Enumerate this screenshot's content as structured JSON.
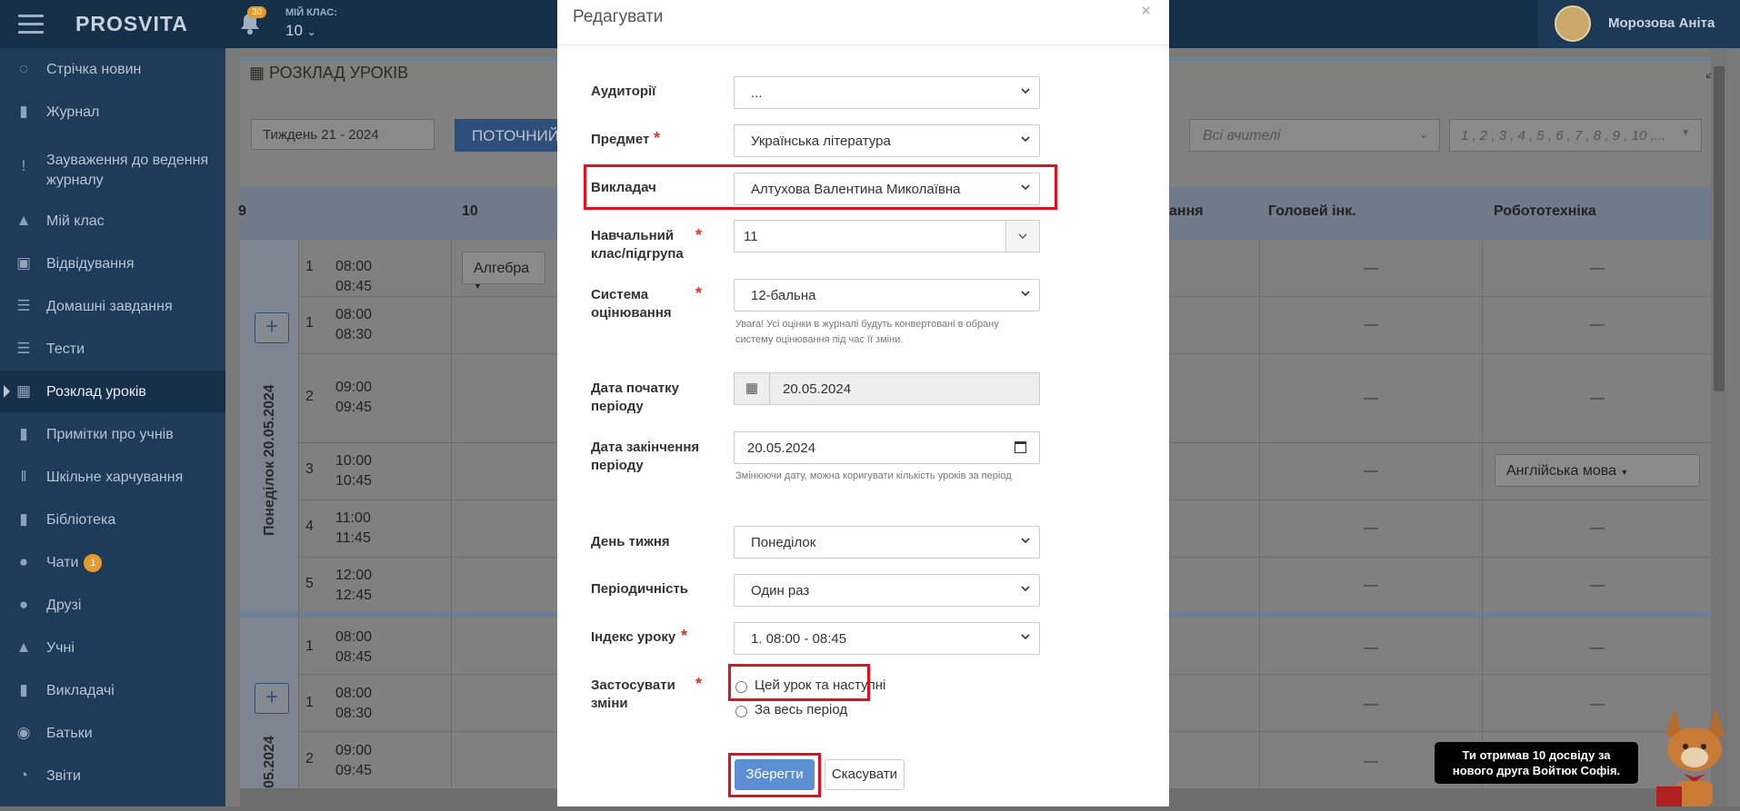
{
  "topbar": {
    "logo": "PROSVITA",
    "notifications_count": "30",
    "my_class_label": "МІЙ КЛАС:",
    "my_class_value": "10",
    "user_name": "Морозова Аніта"
  },
  "sidebar": {
    "items": [
      {
        "label": "Стрічка новин",
        "icon": "rss-icon"
      },
      {
        "label": "Журнал",
        "icon": "bookmark-icon"
      },
      {
        "label": "Зауваження до ведення журналу",
        "icon": "exclamation-icon"
      },
      {
        "label": "Мій клас",
        "icon": "graduation-cap-icon"
      },
      {
        "label": "Відвідування",
        "icon": "copy-icon"
      },
      {
        "label": "Домашні завдання",
        "icon": "list-icon"
      },
      {
        "label": "Тести",
        "icon": "list-check-icon"
      },
      {
        "label": "Розклад уроків",
        "icon": "calendar-icon",
        "active": true
      },
      {
        "label": "Примітки про учнів",
        "icon": "note-icon"
      },
      {
        "label": "Шкільне харчування",
        "icon": "cutlery-icon"
      },
      {
        "label": "Бібліотека",
        "icon": "book-icon"
      },
      {
        "label": "Чати",
        "icon": "chat-icon",
        "badge": "1"
      },
      {
        "label": "Друзі",
        "icon": "users-icon"
      },
      {
        "label": "Учні",
        "icon": "graduation-cap-icon"
      },
      {
        "label": "Викладачі",
        "icon": "id-badge-icon"
      },
      {
        "label": "Батьки",
        "icon": "user-circle-icon"
      },
      {
        "label": "Звіти",
        "icon": "pie-chart-icon"
      }
    ]
  },
  "schedule": {
    "title": "РОЗКЛАД УРОКІВ",
    "week": "Тиждень 21 - 2024",
    "current_button": "ПОТОЧНИЙ",
    "teacher_filter": "Всі вчителі",
    "lessons_filter": "1 , 2 , 3 , 4 , 5 , 6 , 7 , 8 , 9 , 10 ,...",
    "columns": [
      "9",
      "10",
      "ання",
      "Головей інк.",
      "Робототехніка"
    ],
    "day1": "Понеділок 20.05.2024",
    "day2": "05.2024",
    "rows": [
      {
        "num": "1",
        "start": "08:00",
        "end": "08:45"
      },
      {
        "num": "1",
        "start": "08:00",
        "end": "08:30"
      },
      {
        "num": "2",
        "start": "09:00",
        "end": "09:45"
      },
      {
        "num": "3",
        "start": "10:00",
        "end": "10:45"
      },
      {
        "num": "4",
        "start": "11:00",
        "end": "11:45"
      },
      {
        "num": "5",
        "start": "12:00",
        "end": "12:45"
      },
      {
        "num": "1",
        "start": "08:00",
        "end": "08:45"
      },
      {
        "num": "1",
        "start": "08:00",
        "end": "08:30"
      },
      {
        "num": "2",
        "start": "09:00",
        "end": "09:45"
      }
    ],
    "subject_algebra": "Алгебра",
    "subject_english": "Англійська мова",
    "dash": "—",
    "plus": "+"
  },
  "toast": "Ти отримав 10 досвіду за нового друга Войтюк Софія.",
  "modal": {
    "title": "Редагувати",
    "close": "×",
    "auditorium_label": "Аудиторії",
    "auditorium_value": "...",
    "subject_label": "Предмет",
    "subject_value": "Українська література",
    "teacher_label": "Викладач",
    "teacher_value": "Алтухова Валентина Миколаївна",
    "class_label_1": "Навчальний",
    "class_label_2": "клас/підгрупа",
    "class_value": "11",
    "grading_label_1": "Система",
    "grading_label_2": "оцінювання",
    "grading_value": "12-бальна",
    "grading_hint": "Увага! Усі оцінки в журналі будуть конвертовані в обрану систему оцінювання під час її зміни.",
    "start_label_1": "Дата початку",
    "start_label_2": "періоду",
    "start_value": "20.05.2024",
    "end_label_1": "Дата закінчення",
    "end_label_2": "періоду",
    "end_value": "20.05.2024",
    "end_hint": "Змінюючи дату, можна коригувати кількість уроків за період",
    "weekday_label": "День тижня",
    "weekday_value": "Понеділок",
    "period_label": "Періодичність",
    "period_value": "Один раз",
    "lesson_label": "Індекс уроку",
    "lesson_value": "1. 08:00 - 08:45",
    "apply_label_1": "Застосувати",
    "apply_label_2": "зміни",
    "apply_opt1": "Цей урок та наступні",
    "apply_opt2": "За весь період",
    "required_mark": "*",
    "save": "Зберегти",
    "cancel": "Скасувати"
  }
}
